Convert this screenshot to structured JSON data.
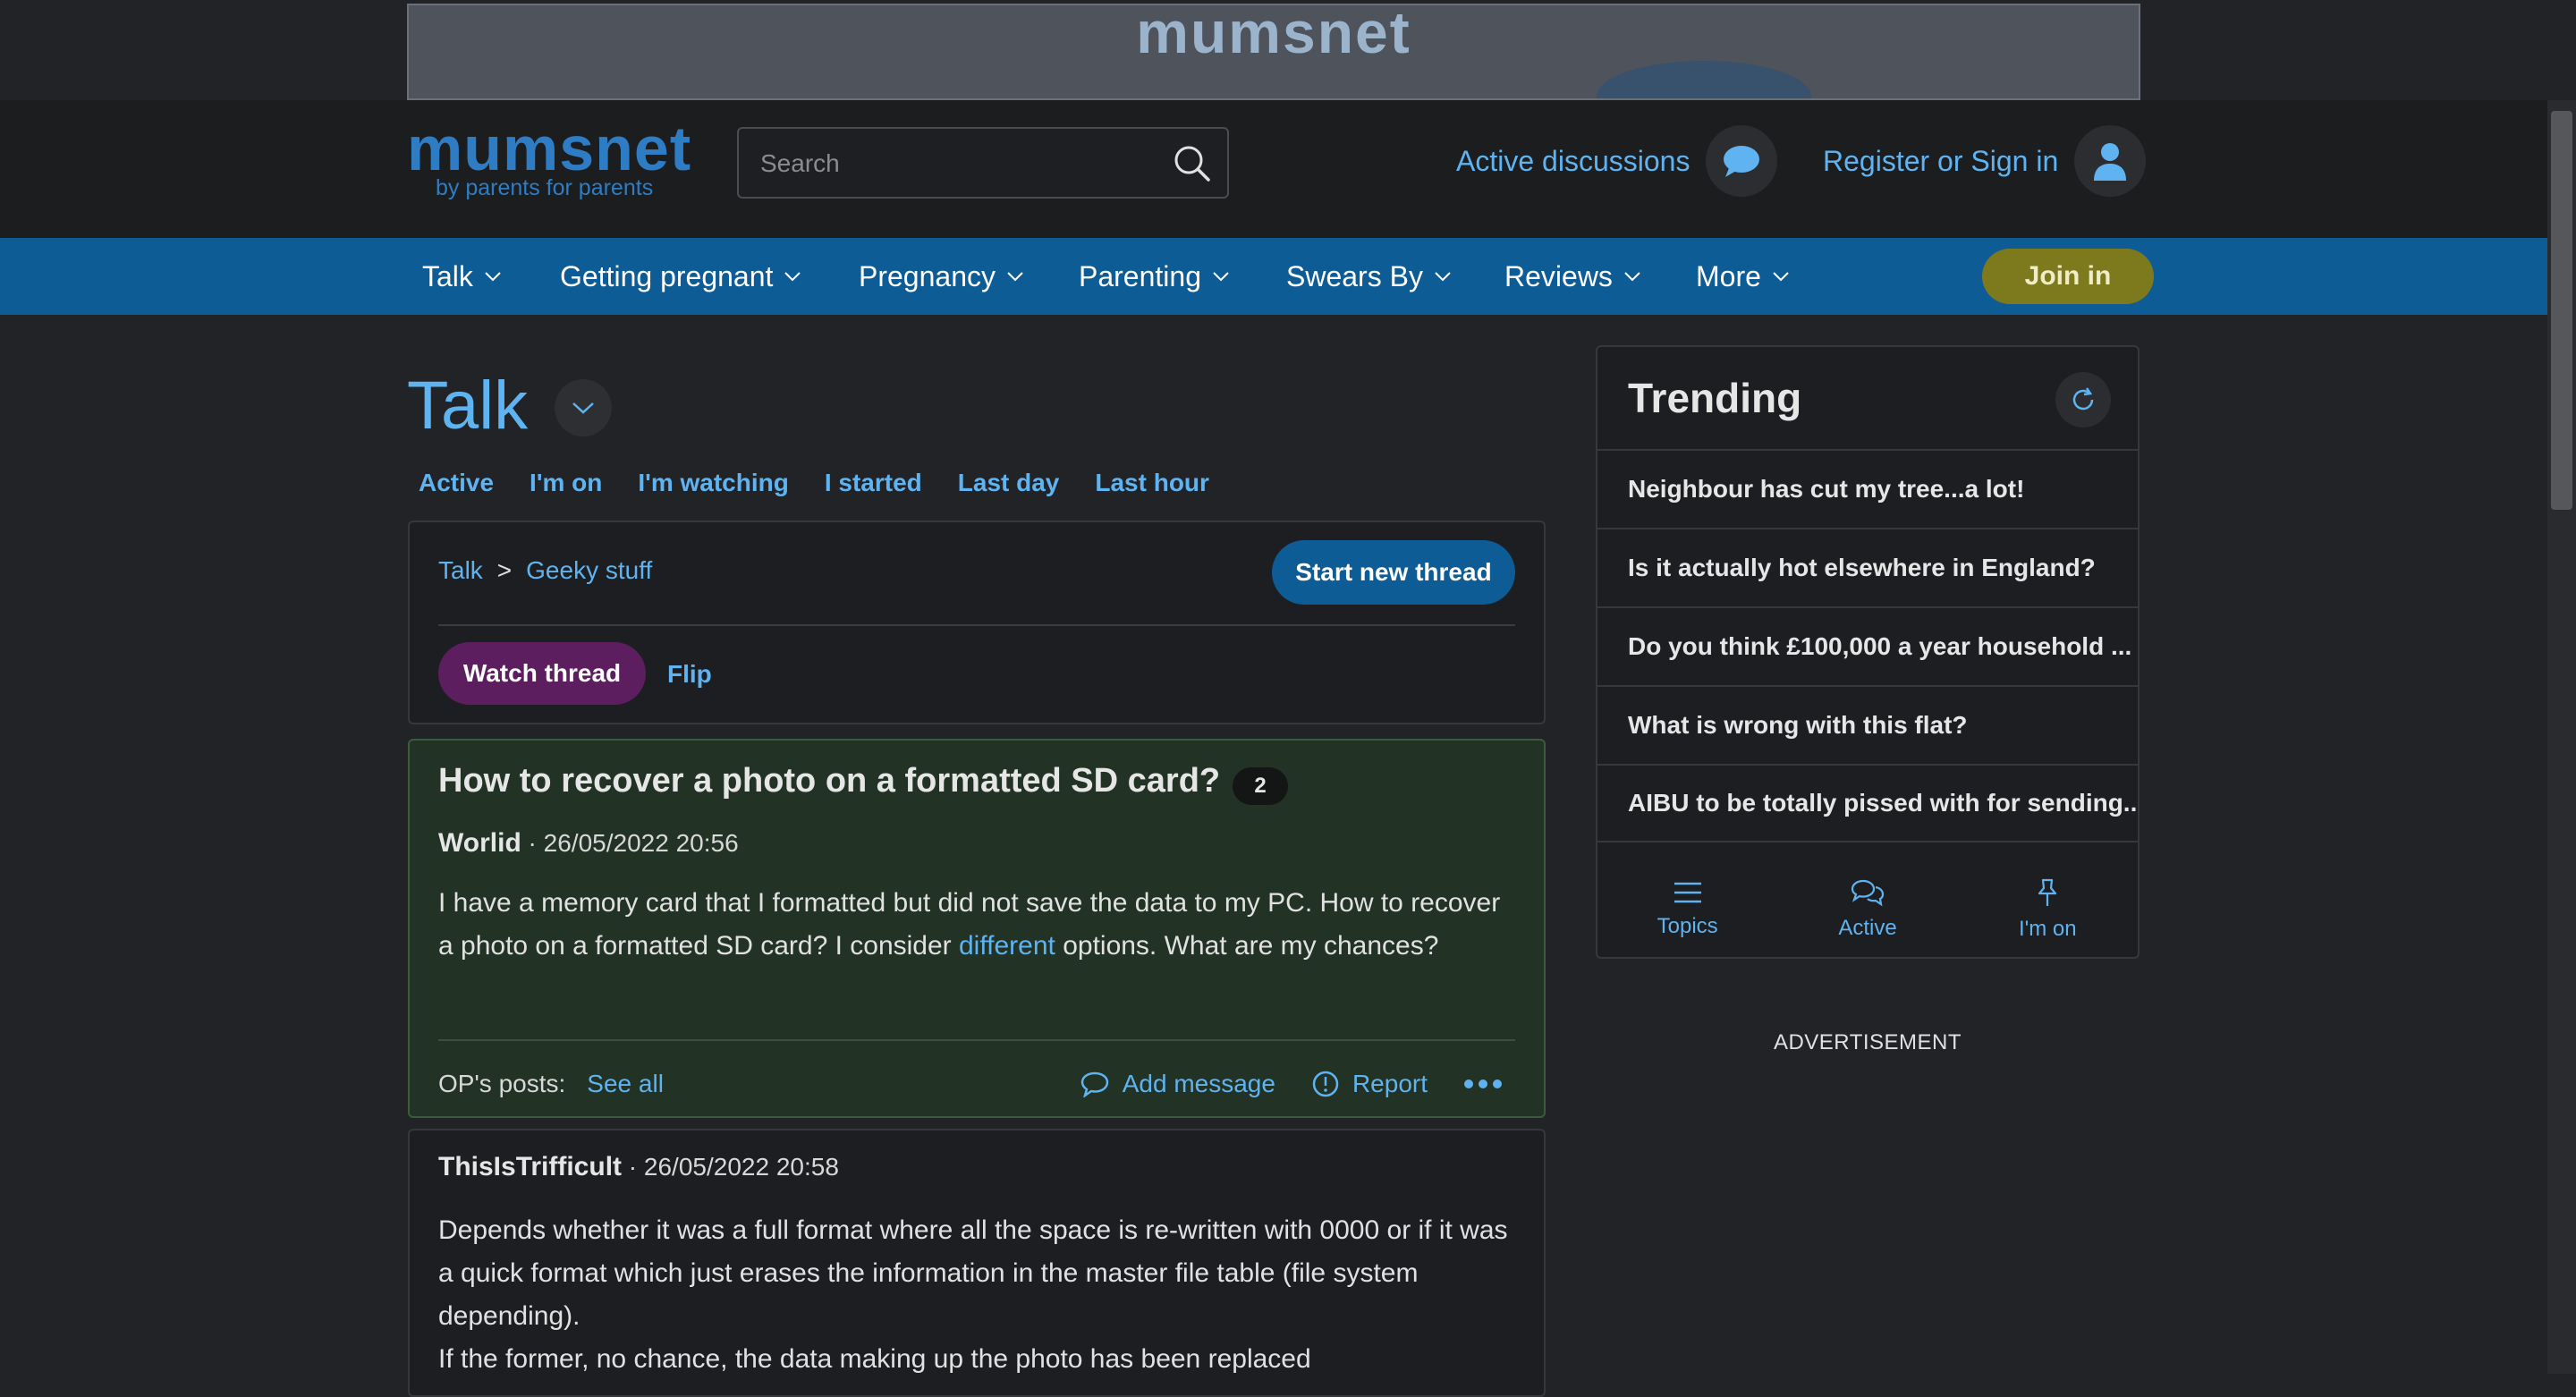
{
  "banner": {
    "logo_text": "mumsnet"
  },
  "header": {
    "logo": "mumsnet",
    "tagline": "by parents for parents",
    "search_placeholder": "Search",
    "active_discussions": "Active discussions",
    "register": "Register or Sign in"
  },
  "nav": {
    "items": [
      "Talk",
      "Getting pregnant",
      "Pregnancy",
      "Parenting",
      "Swears By",
      "Reviews",
      "More"
    ],
    "join": "Join in"
  },
  "talk": {
    "title": "Talk",
    "tabs": [
      "Active",
      "I'm on",
      "I'm watching",
      "I started",
      "Last day",
      "Last hour"
    ]
  },
  "thread_toolbar": {
    "breadcrumb": [
      "Talk",
      "Geeky stuff"
    ],
    "breadcrumb_sep": ">",
    "start_thread": "Start new thread",
    "watch_thread": "Watch thread",
    "flip": "Flip"
  },
  "op": {
    "title": "How to recover a photo on a formatted SD card?",
    "reply_count": "2",
    "author": "Worlid",
    "timestamp": " · 26/05/2022 20:56",
    "body_part1": "I have a memory card that I formatted but did not save the data to my PC. How to recover a photo on a formatted SD card? I consider ",
    "body_link": "different",
    "body_part2": " options. What are my chances?",
    "ops_posts_label": "OP's posts:",
    "see_all": "See all",
    "add_message": "Add message",
    "report": "Report"
  },
  "reply": {
    "author": "ThisIsTrifficult",
    "timestamp": " · 26/05/2022 20:58",
    "body_line1": "Depends whether it was a full format where all the space is re-written with 0000 or if it was a quick format which just erases the information in the master file table (file system depending).",
    "body_line2": "If the former, no chance, the data making up the photo has been replaced"
  },
  "trending": {
    "title": "Trending",
    "items": [
      "Neighbour has cut my tree...a lot!",
      "Is it actually hot elsewhere in England?",
      "Do you think £100,000 a year household ...",
      "What is wrong with this flat?",
      "AIBU to be totally pissed with for sending..."
    ],
    "tabs": [
      "Topics",
      "Active",
      "I'm on"
    ]
  },
  "advertisement": "ADVERTISEMENT",
  "colors": {
    "accent_link": "#5fb3f0",
    "nav_bar": "#0e5c96",
    "join_button": "#7c7a1d",
    "watch_button": "#5c1e5e",
    "op_post_bg": "#223225"
  }
}
